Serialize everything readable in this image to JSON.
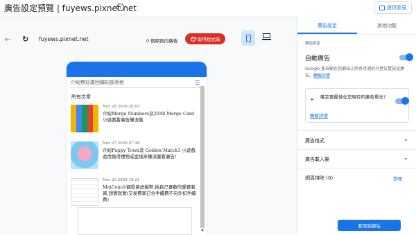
{
  "header": {
    "title": "廣告設定預覽 | fuyews.pixnet.net",
    "info_icon": "i",
    "feedback_label": "提供意見"
  },
  "preview": {
    "url": "fuyews.pixnet.net",
    "ad_count": "0 個網頁內廣告",
    "get_code_label": "取得程式碼"
  },
  "site": {
    "search_placeholder": "介紹無好康回饋的部落格",
    "section_title": "所有文章",
    "articles": [
      {
        "date": "Nov 28 2020 20:02",
        "title": "介紹Merge Numbers及2048 Merge Card 小遊戲看廣告賺流量"
      },
      {
        "date": "Nov 27 2020 07:38",
        "title": "介紹Puppy Town及 Golden Match3 小遊戲遊用換得禮物或金錢來賺流量看廣告!"
      },
      {
        "date": "Nov 23 2020 18:21",
        "title": "MaiCoin小額投資虛擬幣,挑自己喜歡的愛實我買,想實就實(交易費率已含手續費不另外扣手續費)"
      }
    ]
  },
  "panel": {
    "tabs": [
      "廣告設定",
      "其他功能"
    ],
    "section_label": "網站設定",
    "auto_ads_label": "自動廣告",
    "auto_ads_on": true,
    "auto_ads_desc": "Google 會自動在您網站上所有合適的刊登位置放送廣告。",
    "learn_more": "瞭解詳情",
    "optimize_text": "確定要最佳化您現有的廣告單元?",
    "optimize_on": true,
    "optimize_link": "瞭解詳情",
    "rows": [
      {
        "label": "廣告格式"
      },
      {
        "label": "廣告載入量"
      },
      {
        "label": "網頁排除 (0)",
        "action": "管理"
      }
    ],
    "apply_label": "套用到網站",
    "accent_color": "#1a73e8",
    "code_button_color": "#d93025"
  }
}
